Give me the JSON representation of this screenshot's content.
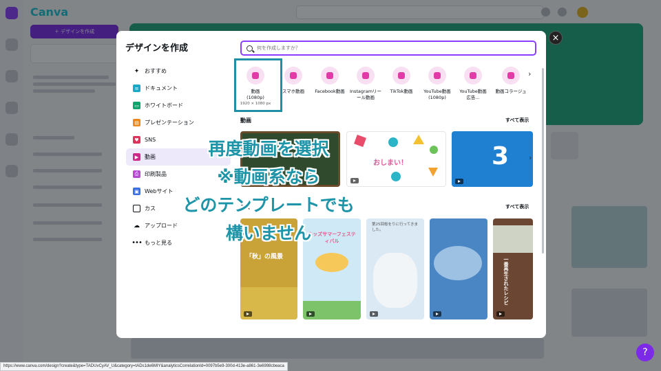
{
  "modal": {
    "title": "デザインを作成",
    "search_placeholder": "何を作成しますか？",
    "close_symbol": "×",
    "menu": [
      {
        "label": "おすすめ",
        "icon": "sparkle-icon",
        "glyph": "✦"
      },
      {
        "label": "ドキュメント",
        "icon": "document-icon",
        "glyph": "≡"
      },
      {
        "label": "ホワイトボード",
        "icon": "whiteboard-icon",
        "glyph": "▭"
      },
      {
        "label": "プレゼンテーション",
        "icon": "presentation-icon",
        "glyph": "▤"
      },
      {
        "label": "SNS",
        "icon": "heart-icon",
        "glyph": "♥"
      },
      {
        "label": "動画",
        "icon": "video-icon",
        "glyph": "▶"
      },
      {
        "label": "印刷製品",
        "icon": "printer-icon",
        "glyph": "⎙"
      },
      {
        "label": "Webサイト",
        "icon": "website-icon",
        "glyph": "▣"
      },
      {
        "label": "カス",
        "icon": "custom-size-icon",
        "glyph": ""
      },
      {
        "label": "アップロード",
        "icon": "upload-cloud-icon",
        "glyph": "☁"
      },
      {
        "label": "もっと見る",
        "icon": "more-dots-icon",
        "glyph": "•••"
      }
    ],
    "active_menu": "動画",
    "video_types": [
      {
        "label": "動画",
        "sub": "(1080p)",
        "size": "1920 × 1080 px"
      },
      {
        "label": "スマホ動画",
        "sub": "",
        "size": ""
      },
      {
        "label": "Facebook動画",
        "sub": "",
        "size": ""
      },
      {
        "label": "Instagramリー",
        "sub": "ール動画",
        "size": ""
      },
      {
        "label": "TikTok動画",
        "sub": "",
        "size": ""
      },
      {
        "label": "YouTube動画",
        "sub": "(1080p)",
        "size": ""
      },
      {
        "label": "YouTube動画",
        "sub": "広告...",
        "size": ""
      },
      {
        "label": "動画コラージュ",
        "sub": "",
        "size": ""
      }
    ],
    "sections": [
      {
        "title": "動画",
        "see_all": "すべて表示"
      },
      {
        "title": "スマ",
        "see_all": "すべて表示"
      }
    ],
    "tiles_text": {
      "oshimai": "おしまい！",
      "number_three": "3",
      "aki": "「秋」の風景",
      "kids_fes": "キッズサマーフェスティバル",
      "sakura": "第25回桜をりに行ってきました。",
      "restaurant": "一番再生されたレシピ"
    }
  },
  "annotation": {
    "lines": [
      "再度動画を選択",
      "※動画系なら",
      "どのテンプレートでも",
      "構いません"
    ],
    "color": "#1d94a8"
  },
  "app": {
    "logo": "Canva",
    "create_button": "＋ デザインを作成",
    "fab_symbol": "?"
  },
  "status_url": "https://www.canva.com/design?create&type=TADUvCyAV_U&category=tADs1de6MIY&analyticsCorrelationId=0097b5e9-300d-413e-a861-3e6998cbeaca"
}
